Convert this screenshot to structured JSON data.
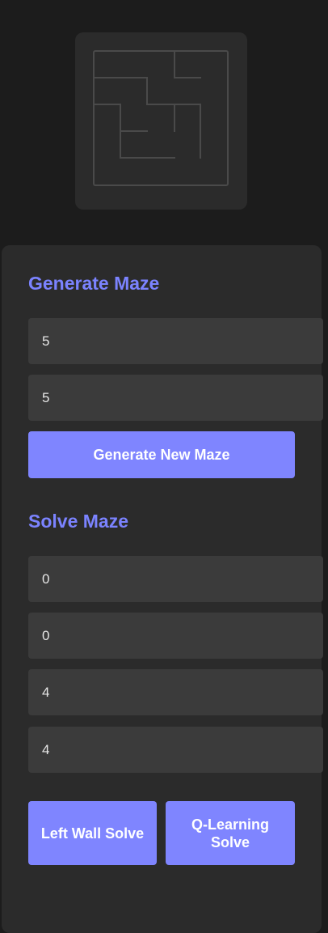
{
  "generate": {
    "heading": "Generate Maze",
    "rows_value": "5",
    "cols_value": "5",
    "button_label": "Generate New Maze"
  },
  "solve": {
    "heading": "Solve Maze",
    "start_x_value": "0",
    "start_y_value": "0",
    "end_x_value": "4",
    "end_y_value": "4",
    "left_wall_button_label": "Left Wall Solve",
    "q_learning_button_label": "Q-Learning Solve"
  },
  "colors": {
    "accent": "#7b83ff",
    "button": "#7f85ff",
    "background": "#1c1c1c",
    "panel": "#2b2b2b",
    "input": "#3b3b3b",
    "maze_wall": "#4a4a4a"
  }
}
